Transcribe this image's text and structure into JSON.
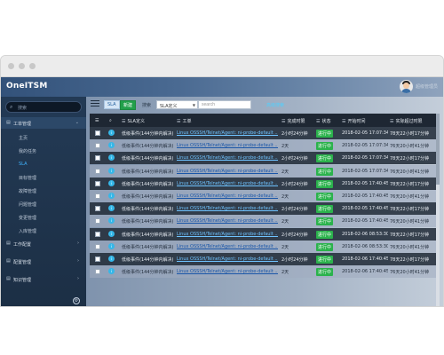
{
  "window": {
    "title": "OneITSM"
  },
  "user": {
    "name": "超级管理员"
  },
  "sidebar": {
    "search_placeholder": "搜索",
    "items": [
      {
        "label": "工单管理",
        "type": "parent",
        "expanded": true
      },
      {
        "label": "主页",
        "type": "sub"
      },
      {
        "label": "我的任务",
        "type": "sub"
      },
      {
        "label": "SLA",
        "type": "sub",
        "active": true
      },
      {
        "label": "目标管理",
        "type": "sub"
      },
      {
        "label": "故障管理",
        "type": "sub"
      },
      {
        "label": "问题管理",
        "type": "sub"
      },
      {
        "label": "变更管理",
        "type": "sub"
      },
      {
        "label": "入库管理",
        "type": "sub"
      },
      {
        "label": "工作配置",
        "type": "parent"
      },
      {
        "label": "配置管理",
        "type": "parent"
      },
      {
        "label": "知识管理",
        "type": "parent"
      }
    ]
  },
  "toolbar": {
    "sla_label": "SLA",
    "new_label": "新建",
    "search_label": "搜索",
    "select_value": "SLA定义",
    "search_placeholder": "search",
    "link_label": "高级搜索"
  },
  "table": {
    "columns": [
      "SLA定义",
      "工单",
      "完成时限",
      "状态",
      "开始时间",
      "实际超过时限"
    ],
    "rows": [
      {
        "sla": "低级事件(144分钟内解决)",
        "ticket": "Linux OSSSH/Telnet/Agent: ni-probe-default ...",
        "limit": "2小时24分钟",
        "status": "进行中",
        "start": "2018-02-05 17:07:34",
        "over": "78天22小时17分钟"
      },
      {
        "sla": "低级事件(144分钟内解决)",
        "ticket": "Linux OSSSH/Telnet/Agent: ni-probe-default ...",
        "limit": "2天",
        "status": "进行中",
        "start": "2018-02-05 17:07:34",
        "over": "76天20小时41分钟"
      },
      {
        "sla": "低级事件(144分钟内解决)",
        "ticket": "Linux OSSSH/Telnet/Agent: ni-probe-default ...",
        "limit": "2小时24分钟",
        "status": "进行中",
        "start": "2018-02-05 17:07:34",
        "over": "78天22小时17分钟"
      },
      {
        "sla": "低级事件(144分钟内解决)",
        "ticket": "Linux OSSSH/Telnet/Agent: ni-probe-default ...",
        "limit": "2天",
        "status": "进行中",
        "start": "2018-02-05 17:07:34",
        "over": "76天20小时41分钟"
      },
      {
        "sla": "低级事件(144分钟内解决)",
        "ticket": "Linux OSSSH/Telnet/Agent: ni-probe-default ...",
        "limit": "2小时24分钟",
        "status": "进行中",
        "start": "2018-02-05 17:40:45",
        "over": "78天22小时17分钟"
      },
      {
        "sla": "低级事件(144分钟内解决)",
        "ticket": "Linux OSSSH/Telnet/Agent: ni-probe-default ...",
        "limit": "2天",
        "status": "进行中",
        "start": "2018-02-05 17:40:45",
        "over": "76天20小时41分钟"
      },
      {
        "sla": "低级事件(144分钟内解决)",
        "ticket": "Linux OSSSH/Telnet/Agent: ni-probe-default ...",
        "limit": "2小时24分钟",
        "status": "进行中",
        "start": "2018-02-05 17:40:45",
        "over": "78天22小时17分钟"
      },
      {
        "sla": "低级事件(144分钟内解决)",
        "ticket": "Linux OSSSH/Telnet/Agent: ni-probe-default ...",
        "limit": "2天",
        "status": "进行中",
        "start": "2018-02-05 17:40:45",
        "over": "76天20小时41分钟"
      },
      {
        "sla": "低级事件(144分钟内解决)",
        "ticket": "Linux OSSSH/Telnet/Agent: ni-probe-default ...",
        "limit": "2小时24分钟",
        "status": "进行中",
        "start": "2018-02-06 08:53:30",
        "over": "78天22小时17分钟"
      },
      {
        "sla": "低级事件(144分钟内解决)",
        "ticket": "Linux OSSSH/Telnet/Agent: ni-probe-default ...",
        "limit": "2天",
        "status": "进行中",
        "start": "2018-02-06 08:53:30",
        "over": "76天20小时41分钟"
      },
      {
        "sla": "低级事件(144分钟内解决)",
        "ticket": "Linux OSSSH/Telnet/Agent: ni-probe-default ...",
        "limit": "2小时24分钟",
        "status": "进行中",
        "start": "2018-02-06 17:40:45",
        "over": "78天22小时17分钟"
      },
      {
        "sla": "低级事件(144分钟内解决)",
        "ticket": "Linux OSSSH/Telnet/Agent: ni-probe-default ...",
        "limit": "2天",
        "status": "进行中",
        "start": "2018-02-06 17:40:45",
        "over": "76天20小时41分钟"
      }
    ]
  },
  "colors": {
    "accent": "#3fb3ff",
    "status_green": "#2bb24c",
    "new_button": "#22a04b",
    "header_dark": "#1e2733"
  }
}
